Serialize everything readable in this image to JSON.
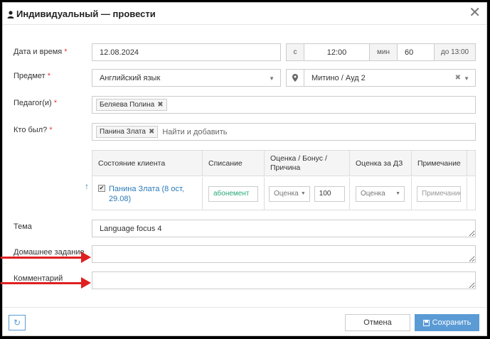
{
  "header": {
    "title": "Индивидуальный — провести",
    "close": "✕"
  },
  "form": {
    "datetime_label": "Дата и время",
    "date_value": "12.08.2024",
    "from_prefix": "с",
    "time_value": "12:00",
    "min_label": "мин",
    "duration_value": "60",
    "until_label": "до 13:00",
    "subject_label": "Предмет",
    "subject_value": "Английский язык",
    "location_value": "Митино / Ауд 2",
    "teacher_label": "Педагог(и)",
    "teacher_tag": "Беляева Полина",
    "attended_label": "Кто был?",
    "attended_tag": "Панина Злата",
    "attended_placeholder": "Найти и добавить",
    "required_mark": "*"
  },
  "table": {
    "headers": [
      "Состояние клиента",
      "Списание",
      "Оценка / Бонус / Причина",
      "Оценка за ДЗ",
      "Примечание"
    ],
    "row": {
      "client_name": "Панина Злата (8 ост, 29.08)",
      "writeoff": "абонемент",
      "grade_placeholder": "Оценка",
      "bonus_value": "100",
      "hw_grade_placeholder": "Оценка",
      "note_placeholder": "Примечание"
    }
  },
  "topic": {
    "label": "Тема",
    "value": "Language focus 4"
  },
  "homework": {
    "label": "Домашнее задание",
    "value": ""
  },
  "comment": {
    "label": "Комментарий",
    "value": ""
  },
  "footer": {
    "cancel_label": "Отмена",
    "save_label": "Сохранить"
  },
  "colors": {
    "primary": "#5b9bd5",
    "annotation_arrow": "#e02020",
    "required": "#e53935",
    "link": "#2a7ab8",
    "writeoff_text": "#2aa876"
  }
}
